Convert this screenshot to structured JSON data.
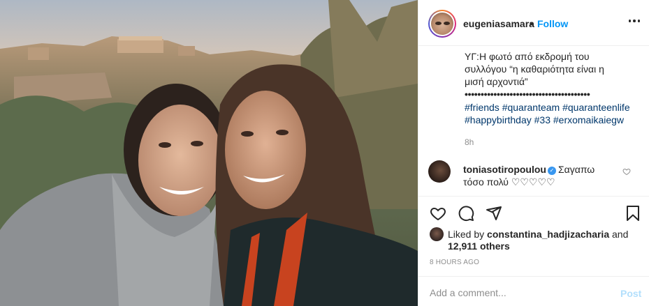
{
  "header": {
    "username": "eugeniasamara",
    "separator": "•",
    "follow_label": "Follow",
    "more_icon": "more-horizontal-icon"
  },
  "caption": {
    "line1": "ΥΓ:Η φωτό από εκδρομή του",
    "line2": "συλλόγου “η καθαριότητα είναι η",
    "line3": "μισή αρχοντιά”",
    "dots": "•••••••••••••••••••••••••••••••••••••••",
    "hashtags_line1": "#friends #quaranteam #quaranteenlife",
    "hashtags_line2": "#happybirthday #33 #erxomaikaiegw",
    "time": "8h"
  },
  "comment": {
    "username": "toniasotiropoulou",
    "verified_icon": "verified-badge-icon",
    "text_line1": "Σαγαπω",
    "text_line2": "τόσο πολύ ♡♡♡♡♡"
  },
  "actions": {
    "like_icon": "heart-icon",
    "comment_icon": "comment-icon",
    "share_icon": "paper-plane-icon",
    "save_icon": "bookmark-icon"
  },
  "likes": {
    "prefix": "Liked by",
    "liker": "constantina_hadjizacharia",
    "and": "and",
    "others": "12,911 others"
  },
  "timestamp": "8 HOURS AGO",
  "comment_input": {
    "placeholder": "Add a comment...",
    "post_label": "Post"
  },
  "colors": {
    "accent": "#0095f6",
    "post_disabled": "#b2dffc",
    "muted": "#8e8e8e",
    "border": "#efefef"
  }
}
